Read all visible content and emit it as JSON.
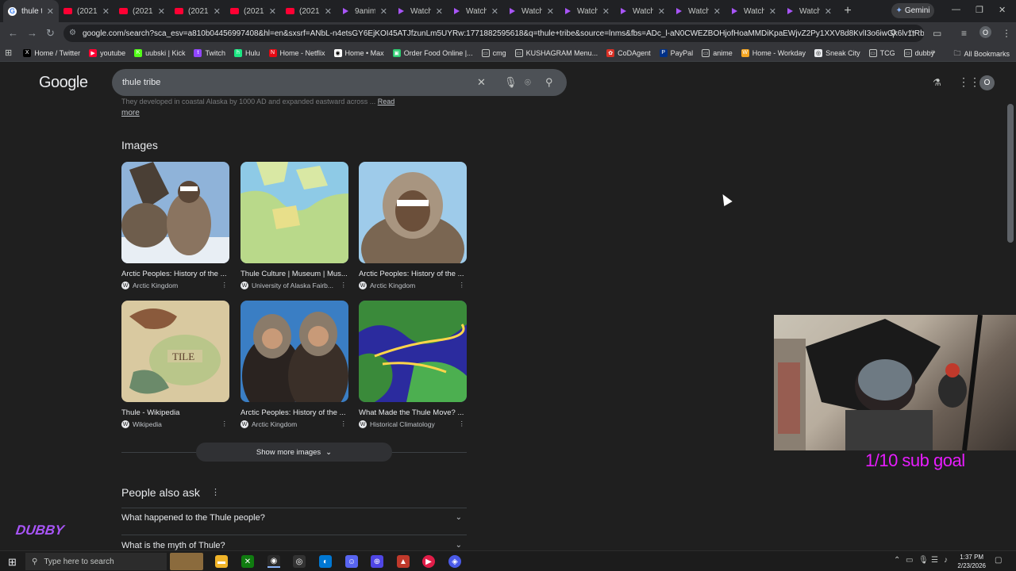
{
  "browser": {
    "tabs": [
      {
        "title": "thule t",
        "icon": "google-icon",
        "active": true
      },
      {
        "title": "(2021)",
        "icon": "youtube-icon"
      },
      {
        "title": "(2021)",
        "icon": "youtube-icon"
      },
      {
        "title": "(2021)",
        "icon": "youtube-icon"
      },
      {
        "title": "(2021)",
        "icon": "youtube-icon"
      },
      {
        "title": "(2021)",
        "icon": "youtube-icon"
      },
      {
        "title": "9anim",
        "icon": "play-icon"
      },
      {
        "title": "Watch",
        "icon": "play-icon"
      },
      {
        "title": "Watch",
        "icon": "play-icon"
      },
      {
        "title": "Watch",
        "icon": "play-icon"
      },
      {
        "title": "Watch",
        "icon": "play-icon"
      },
      {
        "title": "Watch",
        "icon": "play-icon"
      },
      {
        "title": "Watch",
        "icon": "play-icon"
      },
      {
        "title": "Watch",
        "icon": "play-icon"
      },
      {
        "title": "Watch",
        "icon": "play-icon"
      }
    ],
    "gemini_label": "Gemini",
    "url": "google.com/search?sca_esv=a810b04456997408&hl=en&sxsrf=ANbL-n4etsGY6EjKOI45ATJfzunLm5UYRw:1771882595618&q=thule+tribe&source=lnms&fbs=ADc_l-aN0CWEZBOHjofHoaMMDiKpaEWjvZ2Py1XXV8d8KvlI3o6iwGk6lv1tRbZIBNIVs...",
    "profile_initial": "O"
  },
  "bookmarks": [
    {
      "label": "Home / Twitter",
      "icon": "x-icon",
      "color": "#000000"
    },
    {
      "label": "youtube",
      "icon": "youtube-icon",
      "color": "#ff0033"
    },
    {
      "label": "uubski | Kick",
      "icon": "kick-icon",
      "color": "#53fc18"
    },
    {
      "label": "Twitch",
      "icon": "twitch-icon",
      "color": "#9146ff"
    },
    {
      "label": "Hulu",
      "icon": "hulu-icon",
      "color": "#1ce783"
    },
    {
      "label": "Home - Netflix",
      "icon": "netflix-icon",
      "color": "#e50914"
    },
    {
      "label": "Home • Max",
      "icon": "max-icon",
      "color": "#ffffff"
    },
    {
      "label": "Order Food Online |...",
      "icon": "food-icon",
      "color": "#2ecc71"
    },
    {
      "label": "cmg",
      "icon": "folder-icon",
      "color": "#9aa0a6"
    },
    {
      "label": "KUSHAGRAM Menu...",
      "icon": "folder-icon",
      "color": "#9aa0a6"
    },
    {
      "label": "CoDAgent",
      "icon": "codagent-icon",
      "color": "#d93025"
    },
    {
      "label": "PayPal",
      "icon": "paypal-icon",
      "color": "#003087"
    },
    {
      "label": "anime",
      "icon": "folder-icon",
      "color": "#9aa0a6"
    },
    {
      "label": "Home - Workday",
      "icon": "workday-icon",
      "color": "#f5a623"
    },
    {
      "label": "Sneak City",
      "icon": "sneakcity-icon",
      "color": "#e8eaed"
    },
    {
      "label": "TCG",
      "icon": "folder-icon",
      "color": "#9aa0a6"
    },
    {
      "label": "dubby",
      "icon": "folder-icon",
      "color": "#9aa0a6"
    }
  ],
  "all_bookmarks_label": "All Bookmarks",
  "google": {
    "logo": "Google",
    "query": "thule tribe"
  },
  "content": {
    "snippet": "They developed in coastal Alaska by 1000 AD and expanded eastward across ...",
    "snippet_more": "Read",
    "read_more": "more",
    "images_heading": "Images",
    "images": [
      {
        "caption": "Arctic Peoples: History of the ...",
        "source": "Arctic Kingdom",
        "subject": "man in fur parka by reindeer"
      },
      {
        "caption": "Thule Culture | Museum | Mus...",
        "source": "University of Alaska Fairb...",
        "subject": "map of arctic migration"
      },
      {
        "caption": "Arctic Peoples: History of the ...",
        "source": "Arctic Kingdom",
        "subject": "man in fur hood"
      },
      {
        "caption": "Thule - Wikipedia",
        "source": "Wikipedia",
        "subject": "old map with sea creatures"
      },
      {
        "caption": "Arctic Peoples: History of the ...",
        "source": "Arctic Kingdom",
        "subject": "two women in fur parkas"
      },
      {
        "caption": "What Made the Thule Move? ...",
        "source": "Historical Climatology",
        "subject": "map of thule migration routes"
      }
    ],
    "show_more_images": "Show more images",
    "paa_heading": "People also ask",
    "questions": [
      "What happened to the Thule people?",
      "What is the myth of Thule?"
    ]
  },
  "overlay": {
    "sub_goal": "1/10 sub goal",
    "watermark": "DUBBY"
  },
  "taskbar": {
    "search_placeholder": "Type here to search",
    "time": "1:37 PM",
    "date": "2/23/2026"
  },
  "colors": {
    "accent_purple": "#a855f7",
    "sub_goal_magenta": "#e81cff",
    "page_bg": "#1f1f1f"
  }
}
